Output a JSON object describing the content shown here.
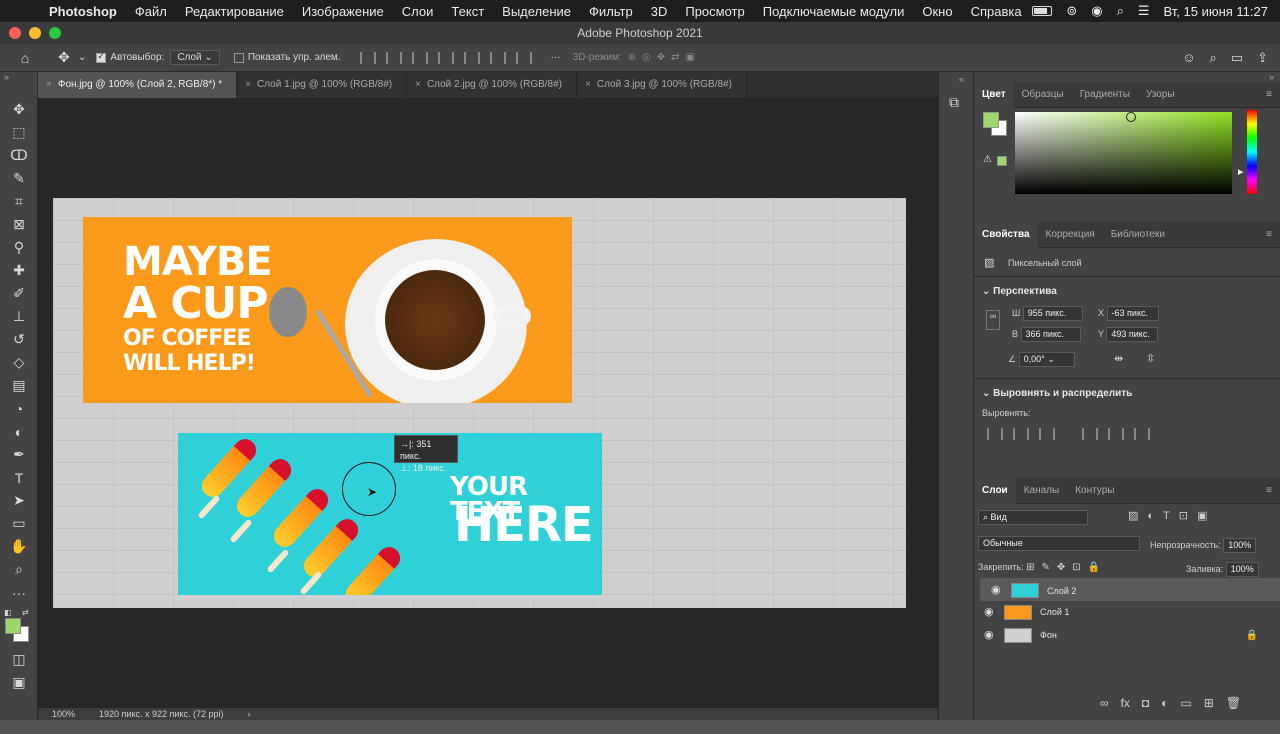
{
  "menubar": {
    "app": "Photoshop",
    "items": [
      "Файл",
      "Редактирование",
      "Изображение",
      "Слои",
      "Текст",
      "Выделение",
      "Фильтр",
      "3D",
      "Просмотр",
      "Подключаемые модули",
      "Окно",
      "Справка"
    ],
    "clock": "Вт, 15 июня  11:27"
  },
  "window": {
    "title": "Adobe Photoshop 2021"
  },
  "options": {
    "autoselect_label": "Автовыбор:",
    "autoselect_value": "Слой",
    "show_controls_label": "Показать упр. элем.",
    "mode3d_label": "3D-режим:"
  },
  "tabs": [
    {
      "label": "Фон.jpg @ 100% (Слой 2, RGB/8*) *",
      "active": true
    },
    {
      "label": "Слой 1.jpg @ 100% (RGB/8#)",
      "active": false
    },
    {
      "label": "Слой 2.jpg @ 100% (RGB/8#)",
      "active": false
    },
    {
      "label": "Слой 3.jpg @ 100% (RGB/8#)",
      "active": false
    }
  ],
  "canvas": {
    "coffee_text": [
      "MAYBE",
      "A CUP",
      "OF COFFEE",
      "WILL HELP!"
    ],
    "ice_text": [
      "YOUR TEXT",
      "HERE"
    ],
    "tooltip_line1": "→|: 351 пикс.",
    "tooltip_line2": "⊥:  18 пикс."
  },
  "status": {
    "zoom": "100%",
    "info": "1920 пикс. x 922 пикс. (72 ppi)"
  },
  "color_panel": {
    "tabs": [
      "Цвет",
      "Образцы",
      "Градиенты",
      "Узоры"
    ],
    "fg_color": "#9fd86a",
    "hue_color": "#8ee020"
  },
  "properties_panel": {
    "tabs": [
      "Свойства",
      "Коррекция",
      "Библиотеки"
    ],
    "kind": "Пиксельный слой",
    "transform_title": "Перспектива",
    "w_label": "Ш",
    "w_value": "955 пикс.",
    "h_label": "В",
    "h_value": "366 пикс.",
    "x_label": "X",
    "x_value": "-63 пикс.",
    "y_label": "Y",
    "y_value": "493 пикс.",
    "angle_value": "0,00°",
    "align_title": "Выровнять и распределить",
    "align_label": "Выровнять:"
  },
  "layers_panel": {
    "tabs": [
      "Слои",
      "Каналы",
      "Контуры"
    ],
    "filter_value": "Вид",
    "blend_mode": "Обычные",
    "opacity_label": "Непрозрачность:",
    "opacity_value": "100%",
    "lock_label": "Закрепить:",
    "fill_label": "Заливка:",
    "fill_value": "100%",
    "layers": [
      {
        "name": "Слой 2",
        "selected": true
      },
      {
        "name": "Слой 1",
        "selected": false
      },
      {
        "name": "Фон",
        "selected": false,
        "locked": true
      }
    ]
  }
}
